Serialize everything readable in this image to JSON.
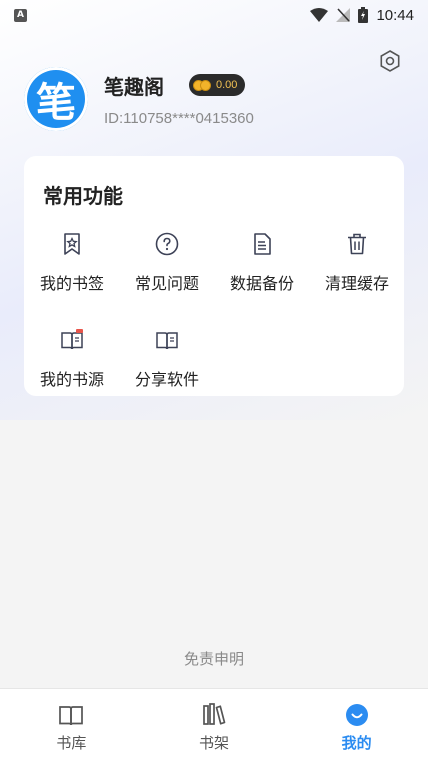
{
  "status_bar": {
    "notification_icon": "A",
    "time": "10:44",
    "icons": [
      "wifi-icon",
      "signal-off-icon",
      "battery-charging-icon"
    ]
  },
  "profile": {
    "avatar_char": "笔",
    "name": "笔趣阁",
    "coins": "0.00",
    "id_text": "ID:110758****0415360"
  },
  "functions": {
    "title": "常用功能",
    "items": [
      {
        "label": "我的书签",
        "icon": "bookmark-icon"
      },
      {
        "label": "常见问题",
        "icon": "question-icon"
      },
      {
        "label": "数据备份",
        "icon": "document-icon"
      },
      {
        "label": "清理缓存",
        "icon": "trash-icon"
      },
      {
        "label": "我的书源",
        "icon": "book-source-icon"
      },
      {
        "label": "分享软件",
        "icon": "share-book-icon"
      }
    ]
  },
  "disclaimer": "免责申明",
  "bottom_nav": {
    "items": [
      {
        "label": "书库",
        "icon": "open-book-icon"
      },
      {
        "label": "书架",
        "icon": "bookshelf-icon"
      },
      {
        "label": "我的",
        "icon": "smile-icon",
        "active": true
      }
    ]
  },
  "colors": {
    "accent": "#2b8cf1",
    "avatar_bg": "#1f8ff0",
    "coin_badge_bg": "#2b2b2b",
    "coin_text": "#f3c253"
  }
}
